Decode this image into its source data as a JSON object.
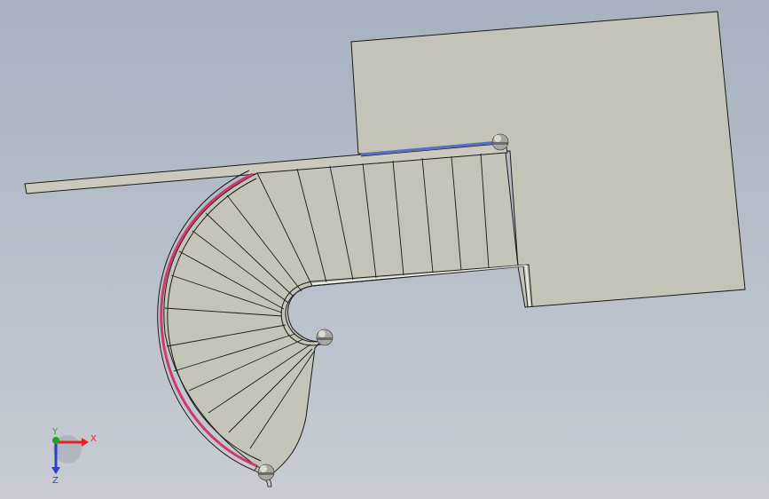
{
  "triad": {
    "x_label": "X",
    "y_label": "Y",
    "z_label": "Z",
    "x_color": "#e0242a",
    "y_color": "#2aa02a",
    "z_color": "#2a3fd0"
  },
  "colors": {
    "model_face": "#c4c3b8",
    "model_edge": "#1a1a1a",
    "handrail_outer": "#d2386a",
    "handrail_inner": "#5a6ec8",
    "post": "#a8a8a0"
  },
  "model": {
    "part": "spiral-staircase-with-landing",
    "straight_steps_count": 8,
    "winder_steps_count": 14
  }
}
